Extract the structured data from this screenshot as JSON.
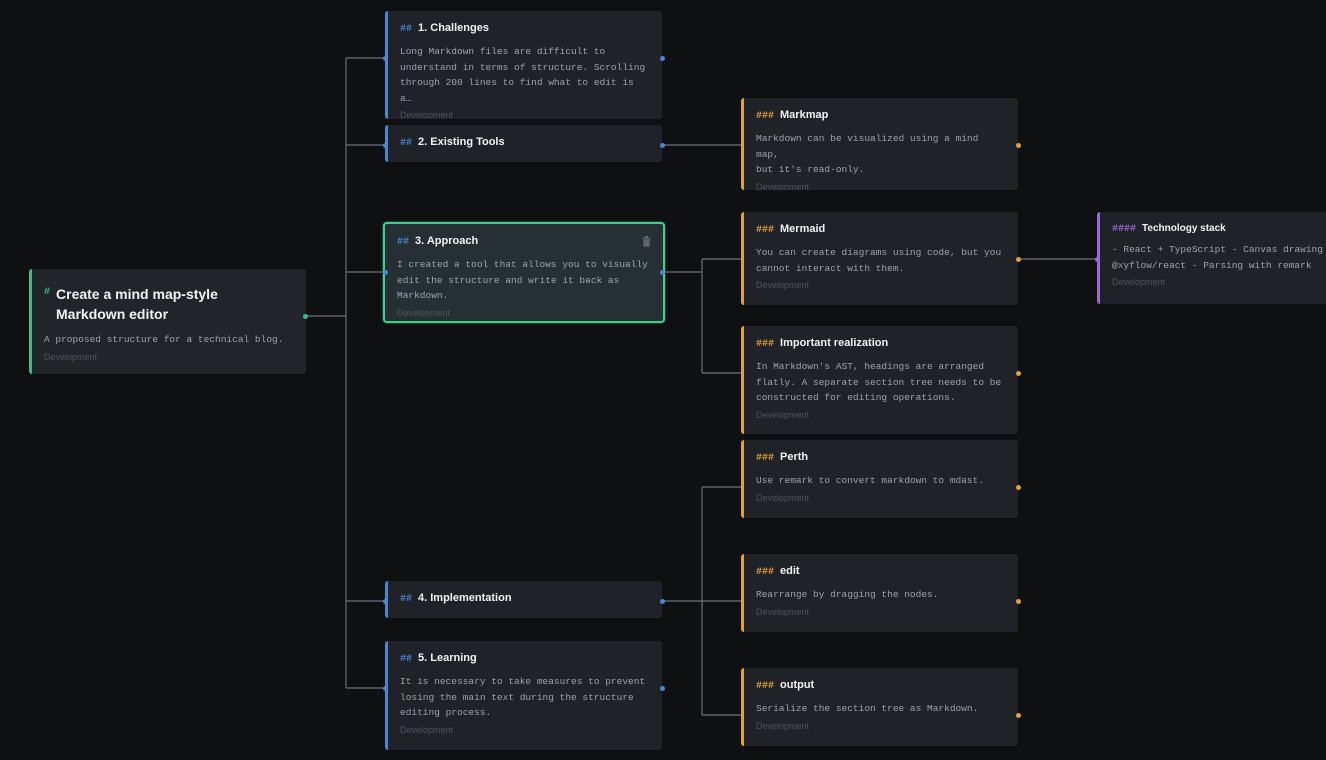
{
  "colors": {
    "background": "#0f1012",
    "h1_accent": "#3fb98a",
    "h2_accent": "#4a86d6",
    "h3_accent": "#e0a13b",
    "h4_accent": "#9b6ad8",
    "selected_border": "#3ecf8e"
  },
  "root": {
    "marker": "#",
    "title_line1": "Create a mind map-style",
    "title_line2": "Markdown editor",
    "body": "A proposed structure for a technical blog.",
    "tag": "Development"
  },
  "sections": {
    "challenges": {
      "marker": "##",
      "title": "1. Challenges",
      "body_lines": [
        "Long Markdown files are difficult to",
        "understand in terms of structure. Scrolling",
        "through 200 lines to find what to edit is a…"
      ],
      "tag": "Development"
    },
    "existing_tools": {
      "marker": "##",
      "title": "2. Existing Tools"
    },
    "approach": {
      "marker": "##",
      "title": "3. Approach",
      "body_lines": [
        "I created a tool that allows you to visually",
        "edit the structure and write it back as",
        "Markdown."
      ],
      "tag": "Development",
      "delete_icon": "trash-icon"
    },
    "implementation": {
      "marker": "##",
      "title": "4. Implementation"
    },
    "learning": {
      "marker": "##",
      "title": "5. Learning",
      "body_lines": [
        "It is necessary to take measures to prevent",
        "losing the main text during the structure",
        "editing process."
      ],
      "tag": "Development"
    }
  },
  "subsections": {
    "markmap": {
      "marker": "###",
      "title": "Markmap",
      "body_lines": [
        "Markdown can be visualized using a mind map,",
        "but it's read-only."
      ],
      "tag": "Development"
    },
    "mermaid": {
      "marker": "###",
      "title": "Mermaid",
      "body_lines": [
        "You can create diagrams using code, but you",
        "cannot interact with them."
      ],
      "tag": "Development"
    },
    "important_realization": {
      "marker": "###",
      "title": "Important realization",
      "body_lines": [
        "In Markdown's AST, headings are arranged",
        "flatly. A separate section tree needs to be",
        "constructed for editing operations."
      ],
      "tag": "Development"
    },
    "perth": {
      "marker": "###",
      "title": "Perth",
      "body_lines": [
        "Use remark to convert markdown to mdast."
      ],
      "tag": "Development"
    },
    "edit": {
      "marker": "###",
      "title": "edit",
      "body_lines": [
        "Rearrange by dragging the nodes."
      ],
      "tag": "Development"
    },
    "output": {
      "marker": "###",
      "title": "output",
      "body_lines": [
        "Serialize the section tree as Markdown."
      ],
      "tag": "Development"
    }
  },
  "leaves": {
    "technology_stack": {
      "marker": "####",
      "title": "Technology stack",
      "body_lines": [
        "- React + TypeScript - Canvas drawing",
        "@xyflow/react - Parsing with remark"
      ],
      "tag": "Development"
    }
  }
}
